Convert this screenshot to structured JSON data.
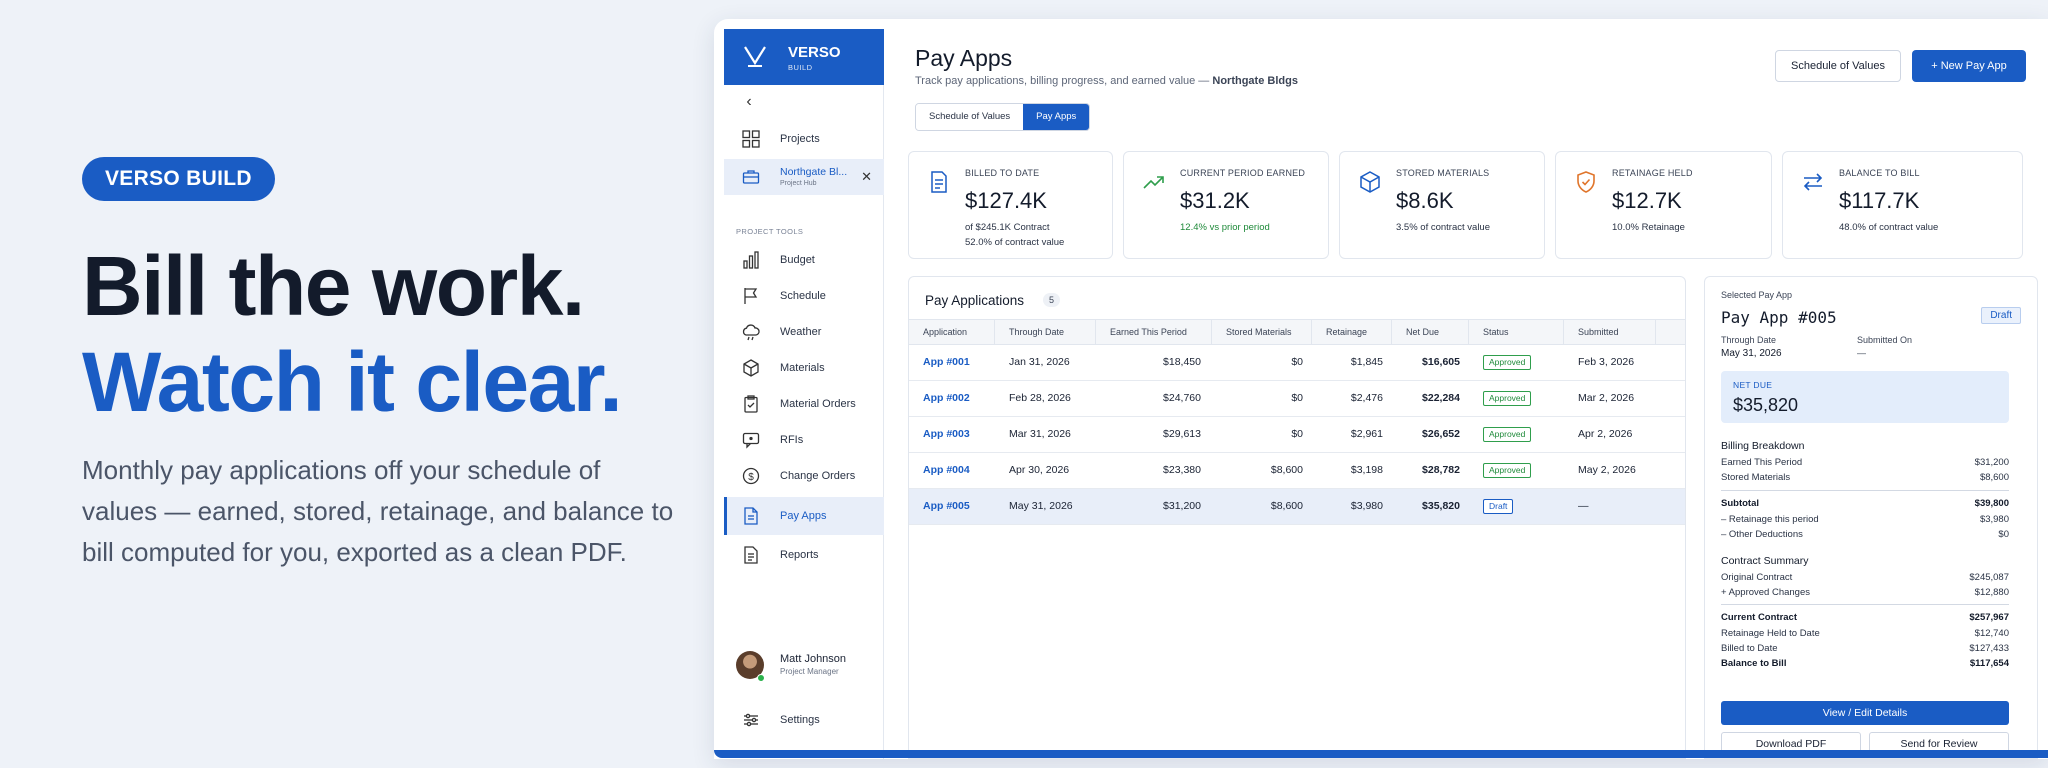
{
  "hero": {
    "badge": "VERSO BUILD",
    "headline_1": "Bill the work.",
    "headline_2": "Watch it clear.",
    "subtitle": "Monthly pay applications off your schedule of values — earned, stored, retainage, and balance to bill computed for you, exported as a clean PDF."
  },
  "brand": {
    "name": "VERSO",
    "sub": "BUILD"
  },
  "sidebar": {
    "projects_label": "Projects",
    "project_name": "Northgate Bl...",
    "project_sub": "Project Hub",
    "section_label": "PROJECT TOOLS",
    "items": [
      {
        "label": "Budget",
        "icon": "bar-chart-icon"
      },
      {
        "label": "Schedule",
        "icon": "flag-icon"
      },
      {
        "label": "Weather",
        "icon": "cloud-icon"
      },
      {
        "label": "Materials",
        "icon": "cube-icon"
      },
      {
        "label": "Material Orders",
        "icon": "clipboard-icon"
      },
      {
        "label": "RFIs",
        "icon": "chat-icon"
      },
      {
        "label": "Change Orders",
        "icon": "dollar-circle-icon"
      },
      {
        "label": "Pay Apps",
        "icon": "document-icon"
      },
      {
        "label": "Reports",
        "icon": "report-icon"
      }
    ],
    "user_name": "Matt Johnson",
    "user_role": "Project Manager",
    "settings_label": "Settings"
  },
  "header": {
    "title": "Pay Apps",
    "subtitle_prefix": "Track pay applications, billing progress, and earned value — ",
    "subtitle_project": "Northgate Bldgs",
    "sov_button": "Schedule of Values",
    "new_button": "+  New Pay App",
    "tab_sov": "Schedule of Values",
    "tab_payapps": "Pay Apps"
  },
  "kpis": [
    {
      "label": "BILLED TO DATE",
      "value": "$127.4K",
      "line1": "of $245.1K Contract",
      "line2": "52.0% of contract value",
      "icon": "document-icon"
    },
    {
      "label": "CURRENT PERIOD EARNED",
      "value": "$31.2K",
      "line1": "12.4% vs prior period",
      "line2": "",
      "icon": "trend-up-icon"
    },
    {
      "label": "STORED MATERIALS",
      "value": "$8.6K",
      "line1": "3.5% of contract value",
      "line2": "",
      "icon": "cube-icon"
    },
    {
      "label": "RETAINAGE HELD",
      "value": "$12.7K",
      "line1": "10.0% Retainage",
      "line2": "",
      "icon": "shield-check-icon"
    },
    {
      "label": "BALANCE TO BILL",
      "value": "$117.7K",
      "line1": "48.0% of contract value",
      "line2": "",
      "icon": "swap-arrows-icon"
    }
  ],
  "table": {
    "title": "Pay Applications",
    "count": "5",
    "columns": [
      "Application",
      "Through Date",
      "Earned This Period",
      "Stored Materials",
      "Retainage",
      "Net Due",
      "Status",
      "Submitted"
    ],
    "rows": [
      {
        "app": "App #001",
        "through": "Jan 31, 2026",
        "earned": "$18,450",
        "stored": "$0",
        "ret": "$1,845",
        "net": "$16,605",
        "status": "Approved",
        "submitted": "Feb 3, 2026"
      },
      {
        "app": "App #002",
        "through": "Feb 28, 2026",
        "earned": "$24,760",
        "stored": "$0",
        "ret": "$2,476",
        "net": "$22,284",
        "status": "Approved",
        "submitted": "Mar 2, 2026"
      },
      {
        "app": "App #003",
        "through": "Mar 31, 2026",
        "earned": "$29,613",
        "stored": "$0",
        "ret": "$2,961",
        "net": "$26,652",
        "status": "Approved",
        "submitted": "Apr 2, 2026"
      },
      {
        "app": "App #004",
        "through": "Apr 30, 2026",
        "earned": "$23,380",
        "stored": "$8,600",
        "ret": "$3,198",
        "net": "$28,782",
        "status": "Approved",
        "submitted": "May 2, 2026"
      },
      {
        "app": "App #005",
        "through": "May 31, 2026",
        "earned": "$31,200",
        "stored": "$8,600",
        "ret": "$3,980",
        "net": "$35,820",
        "status": "Draft",
        "submitted": "—"
      }
    ]
  },
  "detail": {
    "selected_label": "Selected Pay App",
    "title": "Pay App #005",
    "status": "Draft",
    "through_label": "Through Date",
    "through_value": "May 31, 2026",
    "submitted_label": "Submitted On",
    "submitted_value": "—",
    "net_label": "NET DUE",
    "net_value": "$35,820",
    "billing_title": "Billing Breakdown",
    "billing": [
      {
        "label": "Earned This Period",
        "value": "$31,200"
      },
      {
        "label": "Stored Materials",
        "value": "$8,600"
      }
    ],
    "subtotal_label": "Subtotal",
    "subtotal_value": "$39,800",
    "deductions": [
      {
        "label": "– Retainage this period",
        "value": "$3,980"
      },
      {
        "label": "– Other Deductions",
        "value": "$0"
      }
    ],
    "contract_title": "Contract Summary",
    "contract": [
      {
        "label": "Original Contract",
        "value": "$245,087"
      },
      {
        "label": "+ Approved Changes",
        "value": "$12,880"
      }
    ],
    "current_label": "Current Contract",
    "current_value": "$257,967",
    "totals": [
      {
        "label": "Retainage Held to Date",
        "value": "$12,740"
      },
      {
        "label": "Billed to Date",
        "value": "$127,433"
      },
      {
        "label": "Balance to Bill",
        "value": "$117,654"
      }
    ],
    "view_button": "View / Edit Details",
    "download_button": "Download PDF",
    "review_button": "Send for Review"
  },
  "colors": {
    "accent": "#1a5cc4",
    "approved": "#1f8a3a",
    "retainage_icon": "#e0752b",
    "trend_icon": "#2f9e4c"
  }
}
